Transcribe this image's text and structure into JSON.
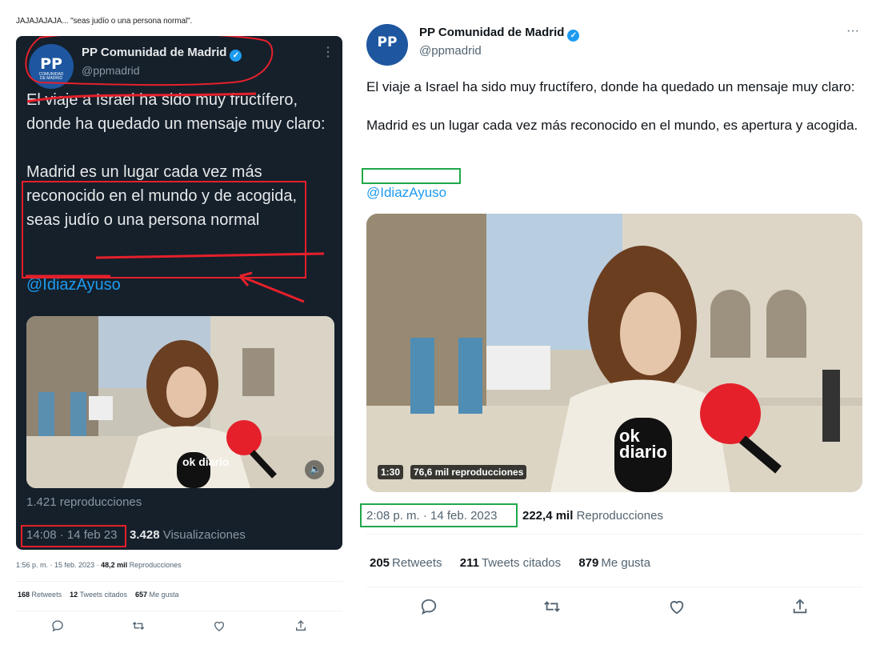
{
  "quote": {
    "text": "JAJAJAJAJA... \"seas judío o una persona normal\"."
  },
  "left_tweet": {
    "account_name": "PP Comunidad de Madrid",
    "handle": "@ppmadrid",
    "avatar_logo": "PP",
    "avatar_subtitle_1": "COMUNIDAD",
    "avatar_subtitle_2": "DE MADRID",
    "paragraph_1": "El viaje a Israel ha sido muy fructífero, donde ha quedado un mensaje muy claro:",
    "paragraph_2": "Madrid es un lugar cada vez más reconocido en el mundo y de acogida, seas judío o una persona normal",
    "mention": "@IdiazAyuso",
    "video_plays": "1.421 reproducciones",
    "timestamp": "14:08 · 14 feb 23",
    "visualizations_count": "3.428",
    "visualizations_label": "Visualizaciones",
    "brand_mic": "ok diario",
    "annotation_colors": {
      "highlight": "#e5202b",
      "box": "#e5202b"
    }
  },
  "left_footer": {
    "timestamp": "1:56 p. m. · 15 feb. 2023 · ",
    "views_count": "48,2 mil",
    "views_label": " Reproducciones",
    "retweets_count": "168",
    "retweets_label": "Retweets",
    "quotes_count": "12",
    "quotes_label": "Tweets citados",
    "likes_count": "657",
    "likes_label": "Me gusta"
  },
  "right_tweet": {
    "account_name": "PP Comunidad de Madrid",
    "handle": "@ppmadrid",
    "avatar_logo": "PP",
    "paragraph_1": "El viaje a Israel ha sido muy fructífero, donde ha quedado un mensaje muy claro:",
    "paragraph_2": "Madrid es un lugar cada vez más reconocido en el mundo, es apertura y acogida.",
    "mention": "@IdiazAyuso",
    "video_duration": "1:30",
    "video_views": "76,6 mil reproducciones",
    "brand_mic": "ok diario",
    "timestamp": "2:08 p. m. · 14 feb. 2023",
    "views_count": "222,4 mil",
    "views_label": "Reproducciones",
    "retweets_count": "205",
    "retweets_label": "Retweets",
    "quotes_count": "211",
    "quotes_label": "Tweets citados",
    "likes_count": "879",
    "likes_label": "Me gusta",
    "annotation_color": "#1fa84a"
  },
  "icons": [
    "reply-icon",
    "retweet-icon",
    "like-icon",
    "share-icon",
    "more-icon",
    "verified-icon",
    "mute-icon"
  ],
  "colors": {
    "twitter_blue": "#1d9bf0",
    "dark_bg": "#15202b",
    "pp_blue": "#1e56a0"
  }
}
